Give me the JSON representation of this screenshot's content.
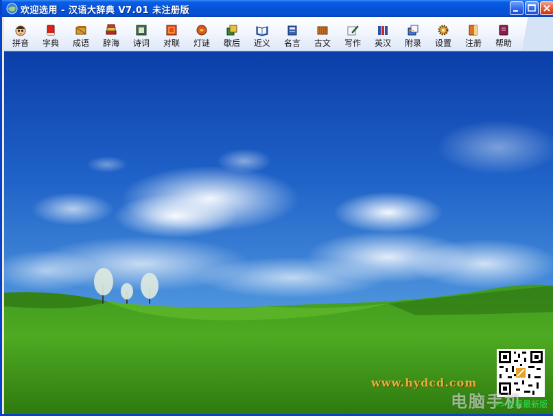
{
  "window": {
    "title": "欢迎选用 - 汉语大辞典 V7.01 未注册版"
  },
  "toolbar": {
    "items": [
      {
        "label": "拼音",
        "icon": "face-icon"
      },
      {
        "label": "字典",
        "icon": "red-book-icon"
      },
      {
        "label": "成语",
        "icon": "scroll-icon"
      },
      {
        "label": "辞海",
        "icon": "books-stack-icon"
      },
      {
        "label": "诗词",
        "icon": "framed-picture-icon"
      },
      {
        "label": "对联",
        "icon": "couplet-icon"
      },
      {
        "label": "灯谜",
        "icon": "lantern-icon"
      },
      {
        "label": "歇后",
        "icon": "cards-icon"
      },
      {
        "label": "近义",
        "icon": "open-book-icon"
      },
      {
        "label": "名言",
        "icon": "notebook-icon"
      },
      {
        "label": "古文",
        "icon": "bamboo-scroll-icon"
      },
      {
        "label": "写作",
        "icon": "pen-paper-icon"
      },
      {
        "label": "英汉",
        "icon": "dictionary-books-icon"
      },
      {
        "label": "附录",
        "icon": "documents-icon"
      },
      {
        "label": "设置",
        "icon": "gear-icon"
      },
      {
        "label": "注册",
        "icon": "key-book-icon"
      },
      {
        "label": "帮助",
        "icon": "help-book-icon"
      }
    ]
  },
  "content": {
    "watermark": "www.hydcd.com",
    "stamp": "电脑手机",
    "new_version_link": ">>查看最新版"
  },
  "colors": {
    "titlebar": "#0553d8",
    "sky_top": "#0b3ea8",
    "grass": "#3f9a1e",
    "watermark": "#e3b03a",
    "link": "#2be04a"
  }
}
